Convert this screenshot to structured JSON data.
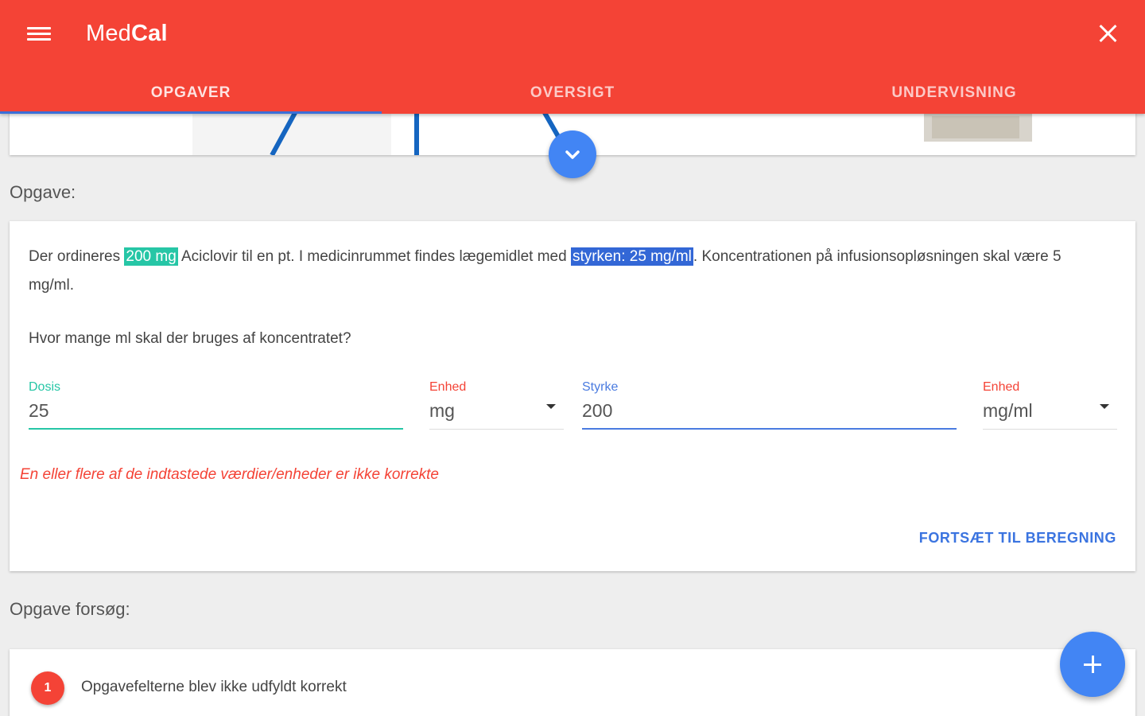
{
  "appbar": {
    "brand_light": "Med",
    "brand_bold": "Cal",
    "menu_icon": "hamburger-menu-icon",
    "close_icon": "close-icon",
    "background": "#f44336"
  },
  "tabs": [
    {
      "label": "OPGAVER",
      "active": true
    },
    {
      "label": "OVERSIGT",
      "active": false
    },
    {
      "label": "UNDERVISNING",
      "active": false
    }
  ],
  "task": {
    "section_label": "Opgave:",
    "text_before": "Der ordineres ",
    "highlight_dose": "200 mg",
    "text_middle": " Aciclovir til en pt. I medicinrummet findes lægemidlet med ",
    "highlight_strength": "styrken: 25 mg/ml",
    "text_after": ". Koncentrationen på infusionsopløsningen skal være 5 mg/ml.",
    "question": "Hvor mange ml skal der bruges af koncentratet?"
  },
  "form": {
    "dosis_label": "Dosis",
    "dosis_value": "25",
    "enhed1_label": "Enhed",
    "enhed1_value": "mg",
    "styrke_label": "Styrke",
    "styrke_value": "200",
    "enhed2_label": "Enhed",
    "enhed2_value": "mg/ml",
    "error": "En eller flere af de indtastede værdier/enheder er ikke korrekte",
    "continue_label": "FORTSÆT TIL BEREGNING"
  },
  "attempts": {
    "section_label": "Opgave forsøg:",
    "items": [
      {
        "number": "1",
        "text": "Opgavefelterne blev ikke udfyldt korrekt"
      }
    ]
  },
  "colors": {
    "accent": "#4285f4",
    "success": "#26c6a6",
    "error": "#f44336"
  }
}
